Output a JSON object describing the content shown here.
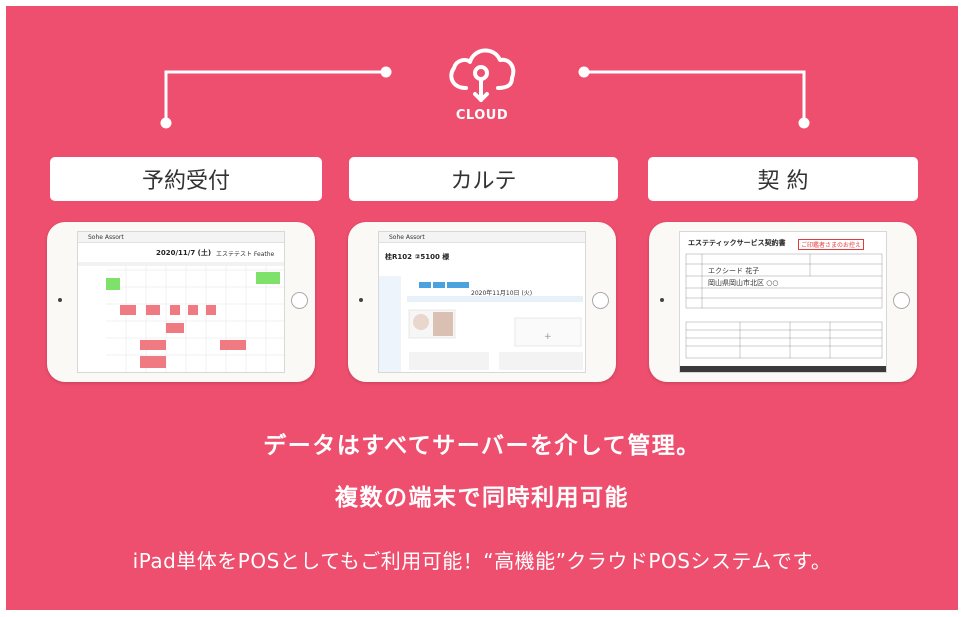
{
  "cloud": {
    "label": "CLOUD",
    "icon": "cloud-upload-icon"
  },
  "features": [
    {
      "label": "予約受付",
      "screen": "reservation-calendar"
    },
    {
      "label": "カルテ",
      "screen": "customer-chart"
    },
    {
      "label": "契 約",
      "screen": "contract-document"
    }
  ],
  "screens": {
    "reservation": {
      "brand": "Sohe Assort",
      "date": "2020/11/7 (土)",
      "salon": "エステテスト Feathe",
      "colors": {
        "green": "#7ee26a",
        "red": "#f07a82"
      }
    },
    "chart": {
      "brand": "Sohe Assort",
      "customer": "桂R102 ②5100 様",
      "visit_date": "2020年11月10日 (火)",
      "add_symbol": "+"
    },
    "contract": {
      "title": "エステティックサービス契約書",
      "stamp": "ご印鑑者さまのお控え",
      "customer": "エクシード 花子",
      "address": "岡山県岡山市北区 ○○"
    }
  },
  "headline": {
    "line1": "データはすべてサーバーを介して管理。",
    "line2": "複数の端末で同時利用可能"
  },
  "subline": "iPad単体をPOSとしてもご利用可能！“高機能”クラウドPOSシステムです。",
  "colors": {
    "background": "#ee4f6e",
    "panel_white": "#ffffff",
    "text_dark": "#333333"
  }
}
